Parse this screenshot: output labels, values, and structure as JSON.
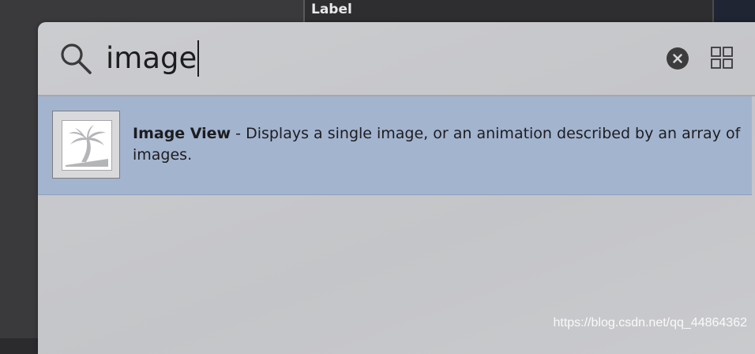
{
  "background": {
    "editor_label": "Label"
  },
  "library": {
    "search": {
      "query": "image",
      "search_icon": "magnifying-glass-icon",
      "clear_icon": "clear-circle-icon",
      "view_toggle_icon": "grid-view-icon"
    },
    "results": [
      {
        "icon": "palm-tree-image-icon",
        "title": "Image View",
        "separator": " - ",
        "description": "Displays a single image, or an animation described by an array of images."
      }
    ]
  },
  "watermark": "https://blog.csdn.net/qq_44864362",
  "colors": {
    "popover_bg": "#c7c8cb",
    "selected_row": "#a3b4cf",
    "text": "#1d1d1f"
  }
}
